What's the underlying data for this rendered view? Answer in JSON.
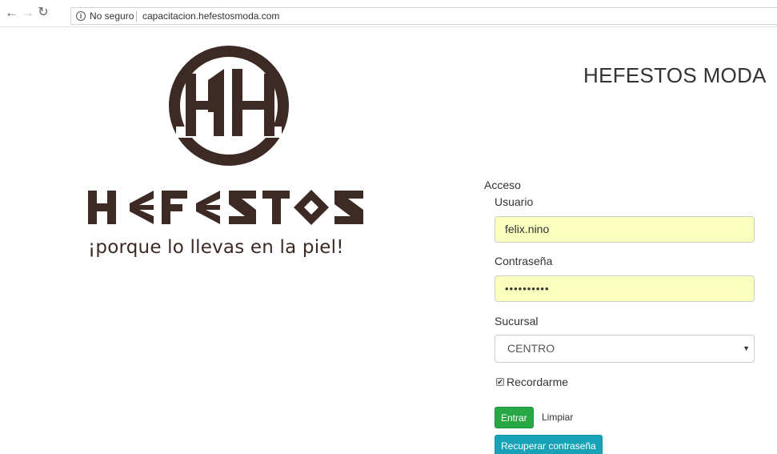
{
  "browser": {
    "security_label": "No seguro",
    "url": "capacitacion.hefestosmoda.com",
    "back_icon": "arrow-left-icon",
    "forward_icon": "arrow-right-icon",
    "reload_icon": "reload-icon",
    "info_icon": "info-icon"
  },
  "logo": {
    "name": "HEFESTOS",
    "tagline": "¡porque lo llevas en la piel!",
    "color": "#3d2a24"
  },
  "header": {
    "title": "HEFESTOS MODA"
  },
  "form": {
    "legend": "Acceso",
    "username_label": "Usuario",
    "username_value": "felix.nino",
    "password_label": "Contraseña",
    "password_value": "••••••••••",
    "branch_label": "Sucursal",
    "branch_value": "CENTRO",
    "remember_label": "Recordarme",
    "remember_checked": true,
    "submit_label": "Entrar",
    "clear_label": "Limpiar",
    "recover_label": "Recuperar contraseña"
  },
  "colors": {
    "autofill": "#faffbd",
    "success": "#28a745",
    "info": "#17a2b8"
  }
}
